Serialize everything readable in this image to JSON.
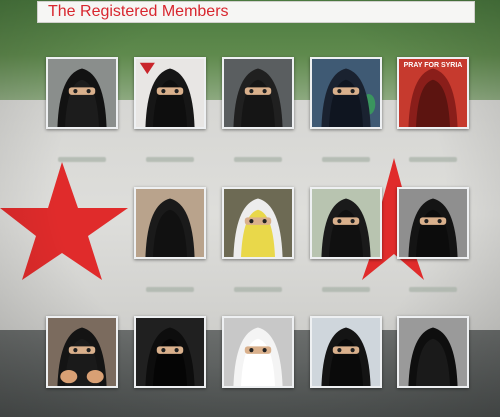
{
  "header": {
    "title": "The Registered Members"
  },
  "members": [
    {
      "caption": "",
      "bg": "#8a8e8c",
      "cloth": "#121212",
      "inner": "#1c1c1c",
      "eyes": true
    },
    {
      "caption": "",
      "bg": "#e8e6e4",
      "cloth": "#161616",
      "inner": "#0e0e0e",
      "eyes": true,
      "flag_accent": "#c9252b"
    },
    {
      "caption": "",
      "bg": "#5a5e60",
      "cloth": "#202020",
      "inner": "#151515",
      "eyes": true
    },
    {
      "caption": "",
      "bg": "#3f5a74",
      "cloth": "#1a2230",
      "inner": "#0f1520",
      "eyes": true,
      "accent": "#3aa05a"
    },
    {
      "caption": "PRAY FOR SYRIA",
      "bg": "#c63a2e",
      "cloth": "#8a1e1a",
      "inner": "#5c1410",
      "eyes": false
    },
    {
      "caption": "",
      "bg": "#b9a38c",
      "cloth": "#1a1a1a",
      "inner": "#111111",
      "eyes": false
    },
    {
      "caption": "",
      "bg": "#6d6a54",
      "cloth": "#ededed",
      "inner": "#e9d84a",
      "eyes": true
    },
    {
      "caption": "",
      "bg": "#b8c4b0",
      "cloth": "#1a1a1a",
      "inner": "#101010",
      "eyes": true
    },
    {
      "caption": "",
      "bg": "#8f8f8f",
      "cloth": "#141414",
      "inner": "#0c0c0c",
      "eyes": true
    },
    {
      "caption": "",
      "bg": "#7b6b5e",
      "cloth": "#141414",
      "inner": "#1a1a1a",
      "eyes": true,
      "hands": "#d9a074"
    },
    {
      "caption": "",
      "bg": "#202020",
      "cloth": "#0d0d0d",
      "inner": "#050505",
      "eyes": true
    },
    {
      "caption": "",
      "bg": "#c8c8c8",
      "cloth": "#f4f4f4",
      "inner": "#ffffff",
      "eyes": true
    },
    {
      "caption": "",
      "bg": "#cfd6dc",
      "cloth": "#141414",
      "inner": "#0a0a0a",
      "eyes": true
    },
    {
      "caption": "",
      "bg": "#9a9a9a",
      "cloth": "#0e0e0e",
      "inner": "#1a1a1a",
      "eyes": false
    }
  ],
  "colors": {
    "title_red": "#d8262e",
    "flag_green": "#4b7a3f",
    "flag_white": "#dededb",
    "flag_black": "#4e5251",
    "star_red": "#e02b2b"
  }
}
